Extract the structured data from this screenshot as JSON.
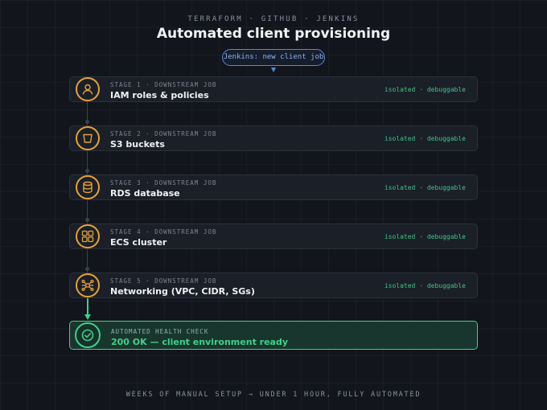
{
  "header": {
    "kicker": "TERRAFORM · GITHUB · JENKINS",
    "title": "Automated client provisioning"
  },
  "trigger": {
    "label": "Jenkins: new client job"
  },
  "stages": [
    {
      "step": "STAGE 1 · DOWNSTREAM JOB",
      "name": "IAM roles & policies",
      "badge": "isolated · debuggable",
      "icon": "user-icon"
    },
    {
      "step": "STAGE 2 · DOWNSTREAM JOB",
      "name": "S3 buckets",
      "badge": "isolated · debuggable",
      "icon": "bucket-icon"
    },
    {
      "step": "STAGE 3 · DOWNSTREAM JOB",
      "name": "RDS database",
      "badge": "isolated · debuggable",
      "icon": "database-icon"
    },
    {
      "step": "STAGE 4 · DOWNSTREAM JOB",
      "name": "ECS cluster",
      "badge": "isolated · debuggable",
      "icon": "containers-icon"
    },
    {
      "step": "STAGE 5 · DOWNSTREAM JOB",
      "name": "Networking (VPC, CIDR, SGs)",
      "badge": "isolated · debuggable",
      "icon": "network-icon"
    }
  ],
  "health": {
    "step": "AUTOMATED HEALTH CHECK",
    "name": "200 OK — client environment ready",
    "icon": "check-icon"
  },
  "footer": "WEEKS OF MANUAL SETUP → UNDER 1 HOUR, FULLY AUTOMATED",
  "colors": {
    "accent_orange": "#e3a23c",
    "accent_green": "#3fd08a",
    "accent_blue": "#5b87d6",
    "background": "#12151c"
  }
}
